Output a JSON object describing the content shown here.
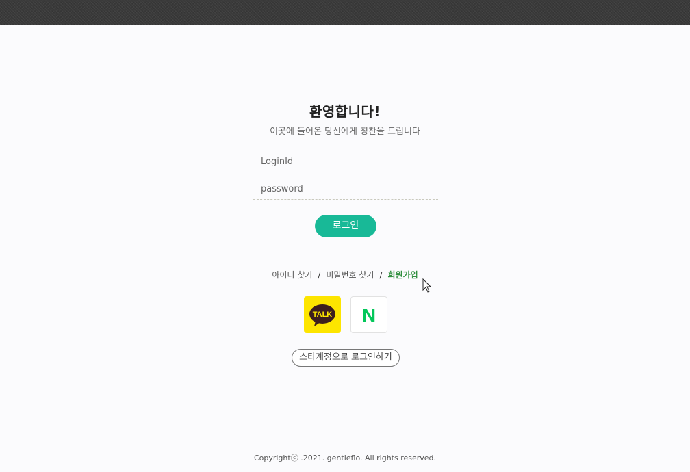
{
  "header": {
    "icon": "checkered-bar"
  },
  "welcome": {
    "title": "환영합니다!",
    "subtitle": "이곳에 들어온 당신에게 칭찬을 드립니다"
  },
  "form": {
    "login_id_placeholder": "LoginId",
    "password_placeholder": "password",
    "login_label": "로그인"
  },
  "links": {
    "find_id": "아이디 찾기",
    "separator": "/",
    "find_password": "비밀번호 찾기",
    "signup": "회원가입"
  },
  "social": {
    "kakao_text": "TALK",
    "naver_text": "N",
    "star_login_label": "스타계정으로 로그인하기"
  },
  "footer": {
    "copyright": "Copyrightⓒ .2021. gentleflo. All rights reserved."
  },
  "colors": {
    "accent": "#18b997",
    "signup": "#2f8f3e",
    "kakao": "#fde500",
    "naver": "#03c75a"
  }
}
